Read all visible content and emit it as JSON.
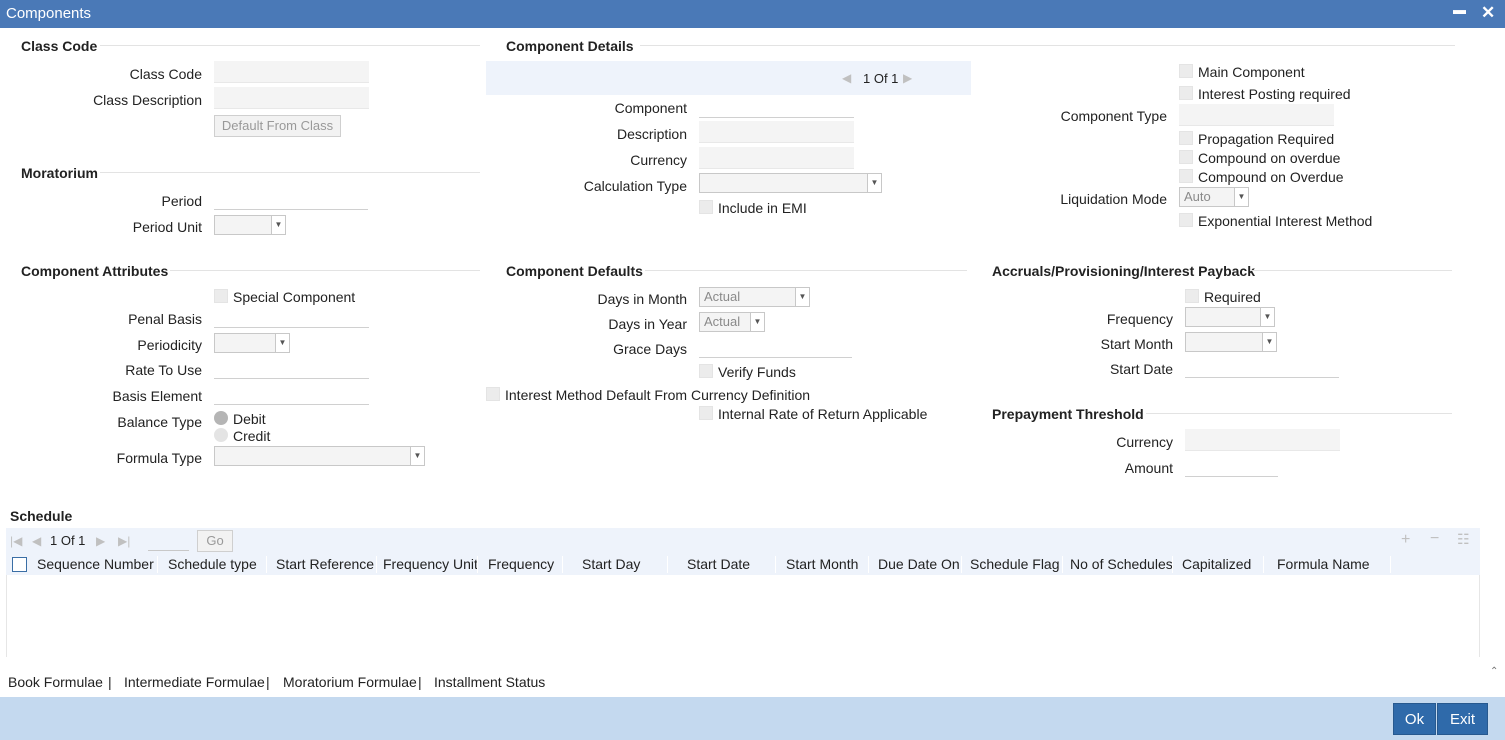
{
  "window": {
    "title": "Components",
    "minimize_glyph": "▬",
    "close_glyph": "✕"
  },
  "class_code": {
    "section": "Class Code",
    "class_code_label": "Class Code",
    "class_description_label": "Class Description",
    "default_button": "Default From Class"
  },
  "moratorium": {
    "section": "Moratorium",
    "period_label": "Period",
    "period_unit_label": "Period Unit"
  },
  "component_details": {
    "section": "Component Details",
    "nav_page": "1 Of 1",
    "component_label": "Component",
    "description_label": "Description",
    "currency_label": "Currency",
    "calculation_type_label": "Calculation Type",
    "include_emi_label": "Include in EMI",
    "main_component_label": "Main Component",
    "interest_posting_label": "Interest Posting required",
    "component_type_label": "Component Type",
    "propagation_label": "Propagation Required",
    "compound_overdue_label": "Compound on overdue",
    "compound_overdue2_label": "Compound on Overdue",
    "liquidation_mode_label": "Liquidation Mode",
    "liquidation_mode_value": "Auto",
    "exponential_label": "Exponential Interest Method"
  },
  "component_attributes": {
    "section": "Component Attributes",
    "special_component_label": "Special Component",
    "penal_basis_label": "Penal Basis",
    "periodicity_label": "Periodicity",
    "rate_to_use_label": "Rate To Use",
    "basis_element_label": "Basis Element",
    "balance_type_label": "Balance Type",
    "debit_label": "Debit",
    "credit_label": "Credit",
    "formula_type_label": "Formula Type"
  },
  "component_defaults": {
    "section": "Component Defaults",
    "days_in_month_label": "Days in Month",
    "days_in_month_value": "Actual",
    "days_in_year_label": "Days in Year",
    "days_in_year_value": "Actual",
    "grace_days_label": "Grace Days",
    "verify_funds_label": "Verify Funds",
    "interest_method_label": "Interest Method Default From Currency Definition",
    "irr_label": "Internal Rate of Return Applicable"
  },
  "accruals": {
    "section": "Accruals/Provisioning/Interest Payback",
    "required_label": "Required",
    "frequency_label": "Frequency",
    "start_month_label": "Start Month",
    "start_date_label": "Start Date"
  },
  "prepayment": {
    "section": "Prepayment Threshold",
    "currency_label": "Currency",
    "amount_label": "Amount"
  },
  "schedule": {
    "section": "Schedule",
    "page": "1 Of 1",
    "go_label": "Go",
    "columns": [
      "Sequence Number",
      "Schedule type",
      "Start Reference",
      "Frequency Unit",
      "Frequency",
      "Start Day",
      "Start Date",
      "Start Month",
      "Due Date On",
      "Schedule Flag",
      "No of Schedules",
      "Capitalized",
      "Formula Name"
    ]
  },
  "footer_links": [
    "Book Formulae",
    "Intermediate Formulae",
    "Moratorium Formulae",
    "Installment Status"
  ],
  "footer_sep": "|",
  "buttons": {
    "ok": "Ok",
    "exit": "Exit"
  }
}
